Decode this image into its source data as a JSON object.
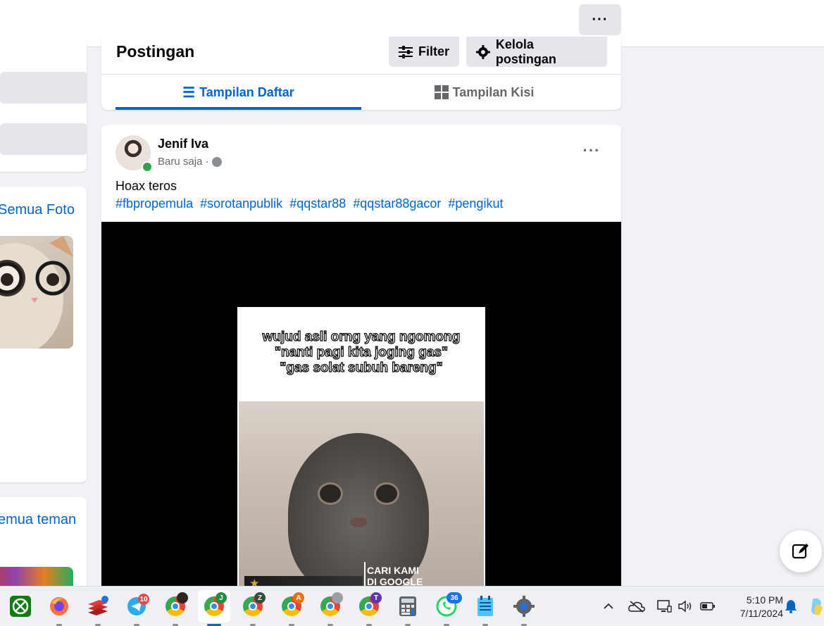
{
  "top": {
    "more_label": "···"
  },
  "left": {
    "see_all_photos": "Semua Foto",
    "see_all_friends": "emua teman"
  },
  "posts_header": {
    "title": "Postingan",
    "filter_label": "Filter",
    "manage_label": "Kelola postingan",
    "tab_list": "Tampilan Daftar",
    "tab_grid": "Tampilan Kisi"
  },
  "post": {
    "author": "Jenif Iva",
    "time": "Baru saja ·",
    "text": "Hoax teros",
    "hashtags": [
      "#fbpropemula",
      "#sorotanpublik",
      "#qqstar88",
      "#qqstar88gacor",
      "#pengikut"
    ],
    "more_label": "···",
    "meme_line1": "wujud asli orng yang ngomong",
    "meme_line2": "\"nanti pagi kita joging gas\"",
    "meme_line3": "\"gas solat subuh bareng\"",
    "video_overlay_1": "CARI KAMI",
    "video_overlay_2": "DI GOOGLE"
  },
  "taskbar": {
    "telegram_badge": "10",
    "chrome_profile_j": "J",
    "chrome_profile_z": "Z",
    "chrome_profile_a": "A",
    "chrome_profile_t": "T",
    "whatsapp_badge": "36",
    "time": "5:10 PM",
    "date": "7/11/2024"
  },
  "colors": {
    "accent": "#0064d1",
    "online": "#31a24c",
    "page_bg": "#f0f2f5"
  }
}
